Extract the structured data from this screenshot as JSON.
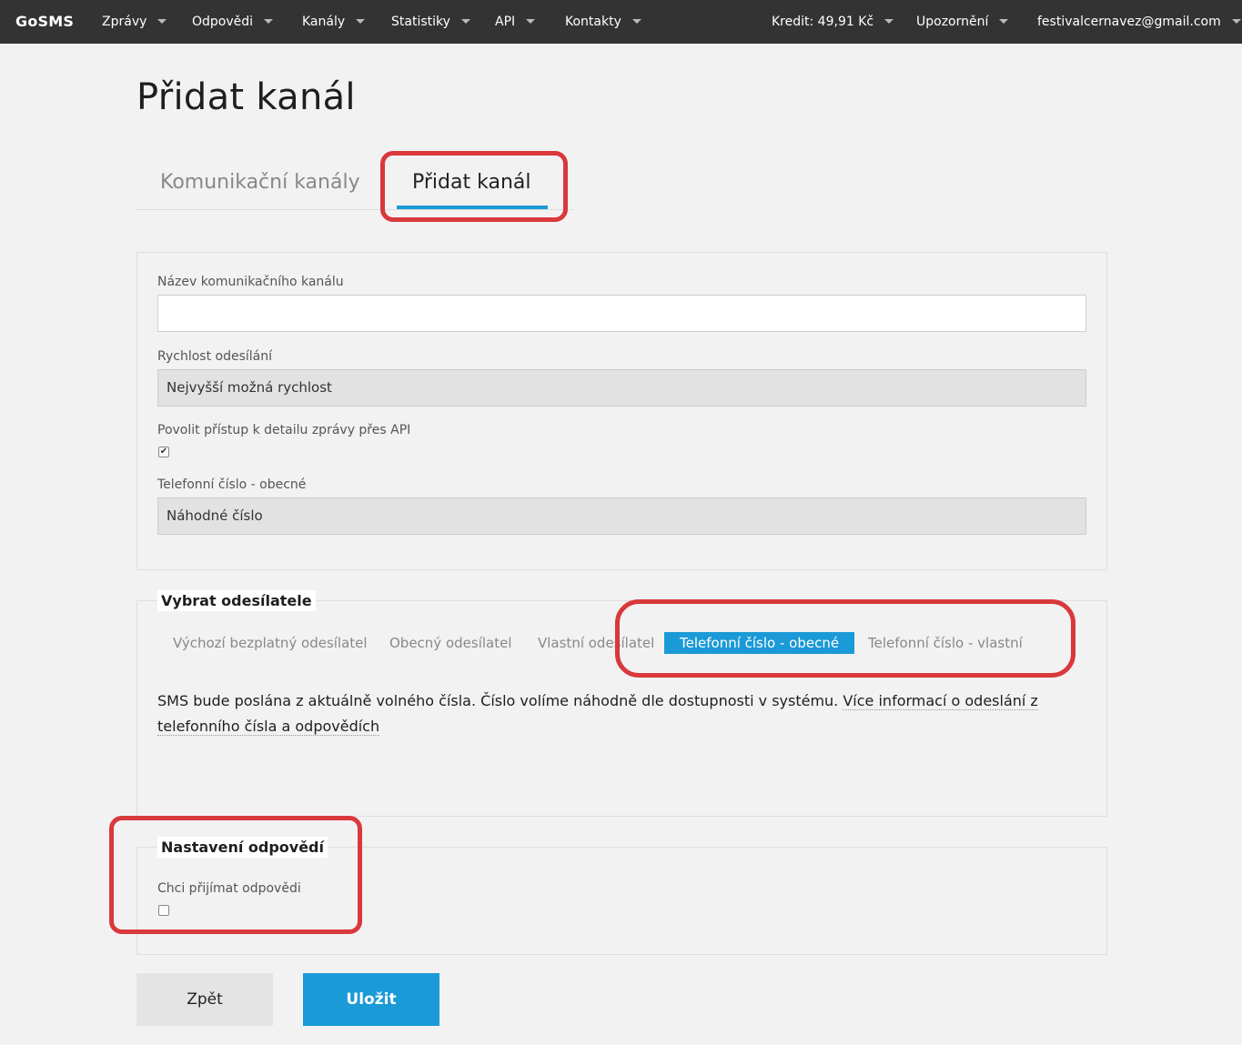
{
  "navbar": {
    "brand": "GoSMS",
    "items": [
      {
        "label": "Zprávy"
      },
      {
        "label": "Odpovědi"
      },
      {
        "label": "Kanály"
      },
      {
        "label": "Statistiky"
      },
      {
        "label": "API"
      },
      {
        "label": "Kontakty"
      }
    ],
    "credit": "Kredit: 49,91 Kč",
    "notifications": "Upozornění",
    "user_email": "festivalcernavez@gmail.com"
  },
  "page": {
    "title": "Přidat kanál"
  },
  "tabs": [
    {
      "label": "Komunikační kanály",
      "active": false
    },
    {
      "label": "Přidat kanál",
      "active": true
    }
  ],
  "form": {
    "channel_name": {
      "label": "Název komunikačního kanálu",
      "value": ""
    },
    "sending_speed": {
      "label": "Rychlost odesílání",
      "value": "Nejvyšší možná rychlost"
    },
    "api_access": {
      "label": "Povolit přístup k detailu zprávy přes API",
      "checked": true,
      "check_glyph": "✔"
    },
    "phone_general": {
      "label": "Telefonní číslo - obecné",
      "value": "Náhodné číslo"
    }
  },
  "sender": {
    "legend": "Vybrat odesílatele",
    "options": [
      {
        "label": "Výchozí bezplatný odesílatel",
        "active": false
      },
      {
        "label": "Obecný odesílatel",
        "active": false
      },
      {
        "label": "Vlastní odesílatel",
        "active": false
      },
      {
        "label": "Telefonní číslo - obecné",
        "active": true
      },
      {
        "label": "Telefonní číslo - vlastní",
        "active": false
      }
    ],
    "info_text": "SMS bude poslána z aktuálně volného čísla. Číslo volíme náhodně dle dostupnosti v systému.",
    "info_link": "Více informací o odeslání z telefonního čísla a odpovědích"
  },
  "replies": {
    "legend": "Nastavení odpovědí",
    "receive_label": "Chci přijímat odpovědi",
    "receive_checked": false
  },
  "buttons": {
    "back": "Zpět",
    "save": "Uložit"
  },
  "colors": {
    "navbar": "#333333",
    "accent": "#1a9ad6",
    "annotation": "#d9383c",
    "background": "#f2f2f2"
  }
}
